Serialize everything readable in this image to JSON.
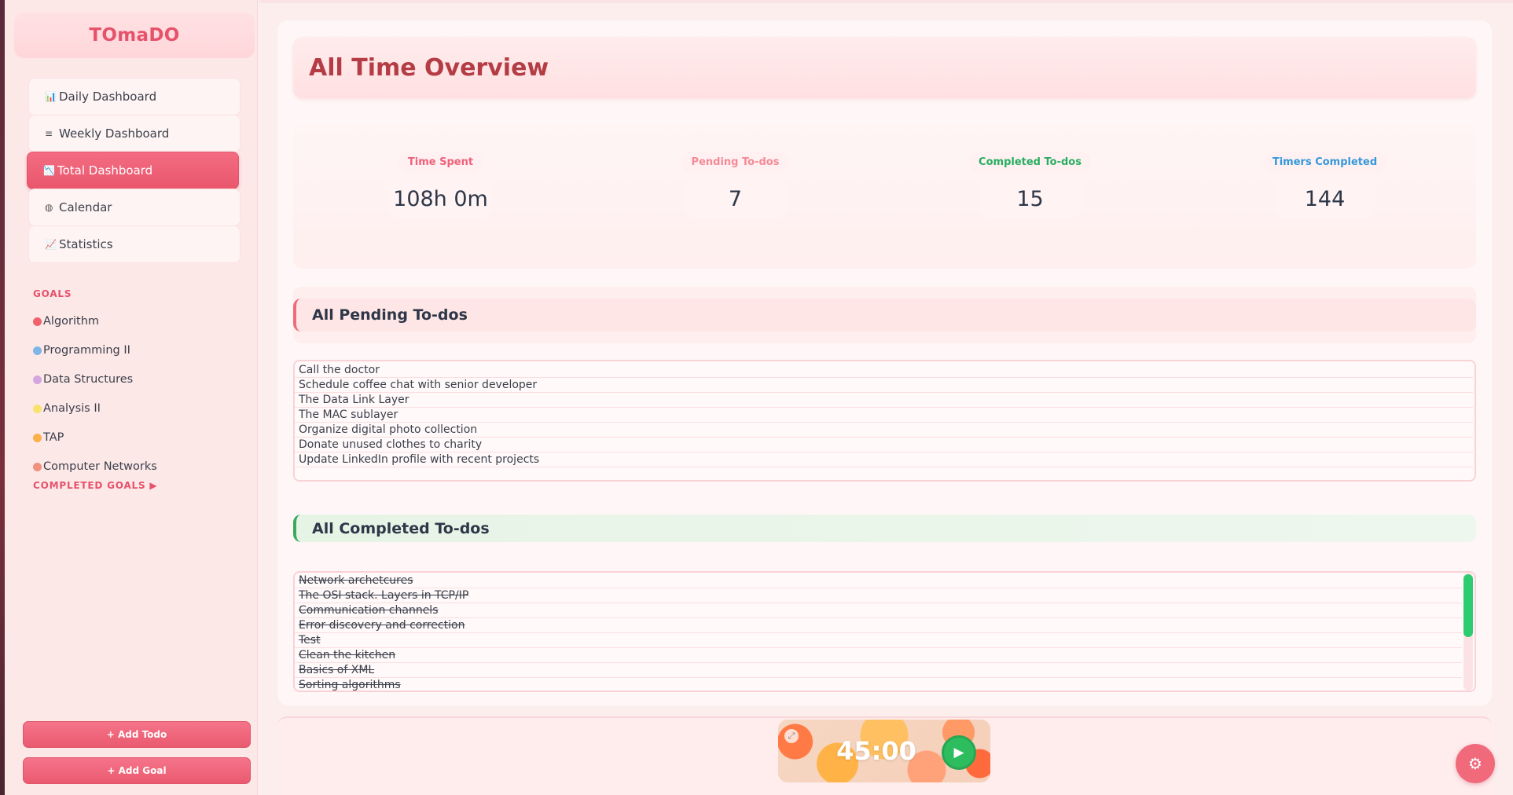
{
  "app": {
    "brand": "TOmaDO"
  },
  "nav": [
    {
      "icon": "📊",
      "label": "Daily Dashboard"
    },
    {
      "icon": "≡",
      "label": "Weekly Dashboard"
    },
    {
      "icon": "📉",
      "label": "Total Dashboard"
    },
    {
      "icon": "◍",
      "label": "Calendar"
    },
    {
      "icon": "📈",
      "label": "Statistics"
    }
  ],
  "goals": {
    "title": "GOALS",
    "items": [
      {
        "label": "Algorithm",
        "color": "#f0616c"
      },
      {
        "label": "Programming II",
        "color": "#7fb6e8"
      },
      {
        "label": "Data Structures",
        "color": "#d3a6e0"
      },
      {
        "label": "Analysis II",
        "color": "#f7e36b"
      },
      {
        "label": "TAP",
        "color": "#fbb04a"
      },
      {
        "label": "Computer Networks",
        "color": "#f2907f"
      }
    ],
    "completed_label": "COMPLETED GOALS ▶"
  },
  "buttons": {
    "add_todo": "+ Add Todo",
    "add_goal": "+ Add Goal"
  },
  "overview": {
    "title": "All Time Overview",
    "stats": [
      {
        "label": "Time Spent",
        "value": "108h 0m",
        "color": "#f0617a"
      },
      {
        "label": "Pending To-dos",
        "value": "7",
        "color": "#f58a97"
      },
      {
        "label": "Completed To-dos",
        "value": "15",
        "color": "#27ae60"
      },
      {
        "label": "Timers Completed",
        "value": "144",
        "color": "#3498db"
      }
    ]
  },
  "pending": {
    "title": "All Pending To-dos",
    "items": [
      "Call the doctor",
      "Schedule coffee chat with senior developer",
      "The Data Link Layer",
      "The MAC sublayer",
      "Organize digital photo collection",
      "Donate unused clothes to charity",
      "Update LinkedIn profile with recent projects"
    ]
  },
  "completed": {
    "title": "All Completed To-dos",
    "items": [
      "Network archetcures",
      "The OSI stack. Layers in TCP/IP",
      "Communication channels",
      "Error discovery and correction",
      "Test",
      "Clean the kitchen",
      "Basics of XML",
      "Sorting algorithms"
    ]
  },
  "timer": {
    "time": "45:00",
    "play_icon": "▶",
    "expand_icon": "⤢"
  },
  "settings": {
    "icon": "⚙"
  }
}
